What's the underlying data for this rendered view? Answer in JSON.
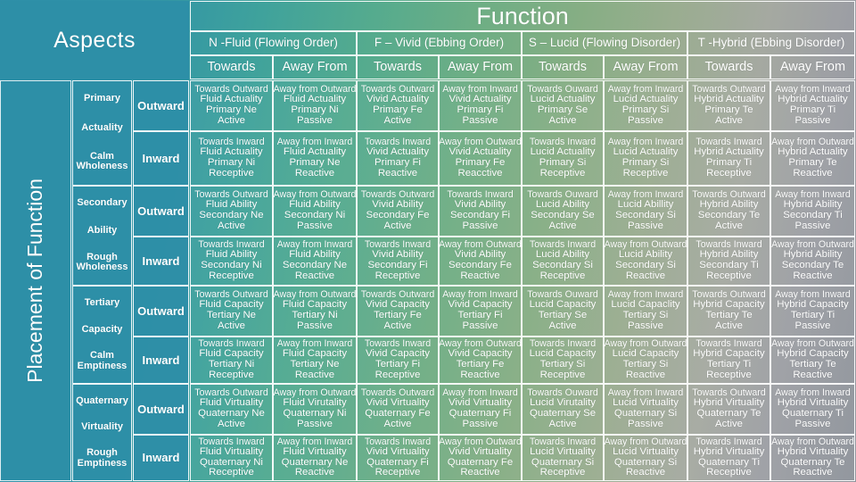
{
  "corner": {
    "aspects_label": "Aspects",
    "placement_label": "Placement of Function"
  },
  "header": {
    "function_label": "Function",
    "functions": [
      {
        "label": "N -Fluid (Flowing Order)"
      },
      {
        "label": "F – Vivid (Ebbing Order)"
      },
      {
        "label": "S – Lucid (Flowing Disorder)"
      },
      {
        "label": "T -Hybrid (Ebbing Disorder)"
      }
    ],
    "directions": [
      "Towards",
      "Away From",
      "Towards",
      "Away From",
      "Towards",
      "Away From",
      "Towards",
      "Away From"
    ]
  },
  "aspect_groups": [
    {
      "rank": "Primary",
      "aspect": "Actuality",
      "quality": "Calm Wholeness",
      "quality_line1": "Calm",
      "quality_line2": "Wholeness"
    },
    {
      "rank": "Secondary",
      "aspect": "Ability",
      "quality": "Rough Wholeness",
      "quality_line1": "Rough",
      "quality_line2": "Wholeness"
    },
    {
      "rank": "Tertiary",
      "aspect": "Capacity",
      "quality": "Calm Emptiness",
      "quality_line1": "Calm",
      "quality_line2": "Emptiness"
    },
    {
      "rank": "Quaternary",
      "aspect": "Virtuality",
      "quality": "Rough Emptiness",
      "quality_line1": "Rough",
      "quality_line2": "Emptiness"
    }
  ],
  "directions_rows": [
    "Outward",
    "Inward"
  ],
  "cells": [
    [
      [
        "Towards Outward",
        "Fluid Actuality",
        "Primary Ne",
        "Active"
      ],
      [
        "Away from Outward",
        "Fluid Actuality",
        "Primary Ni",
        "Passive"
      ],
      [
        "Towards Outward",
        "Vivid Actuality",
        "Primary Fe",
        "Active"
      ],
      [
        "Away from Inward",
        "Vivid Actuality",
        "Primary Fi",
        "Passive"
      ],
      [
        "Towards Ouward",
        "Lucid Actuality",
        "Primary Se",
        "Active"
      ],
      [
        "Away from Inward",
        "Lucid Actuality",
        "Primary Si",
        "Passive"
      ],
      [
        "Towards Outward",
        "Hybrid Actuality",
        "Primary Te",
        "Active"
      ],
      [
        "Away from Inward",
        "Hybrid Actuality",
        "Primary Ti",
        "Passive"
      ]
    ],
    [
      [
        "Towards Inward",
        "Fluid Actuality",
        "Primary Ni",
        "Receptive"
      ],
      [
        "Away from Inward",
        "Fluid Actuality",
        "Primary Ne",
        "Reactive"
      ],
      [
        "Towards Inward",
        "Vivid Actuality",
        "Primary Fi",
        "Reactive"
      ],
      [
        "Away from Outward",
        "Vivid Actuality",
        "Primary Fe",
        "Reacctive"
      ],
      [
        "Towards Inward",
        "Lucid Actuality",
        "Primary Si",
        "Receptive"
      ],
      [
        "Away from Inward",
        "Lucid Actuality",
        "Primary Si",
        "Receptive"
      ],
      [
        "Towards Inward",
        "Hybrid Actuality",
        "Primary Ti",
        "Receptive"
      ],
      [
        "Away from Outward",
        "Hybrid Actuality",
        "Primary Te",
        "Reactive"
      ]
    ],
    [
      [
        "Towards Outward",
        "Fluid Ability",
        "Secondary Ne",
        "Active"
      ],
      [
        "Away from Outward",
        "Fluid Ability",
        "Secondary Ni",
        "Passive"
      ],
      [
        "Towards Outward",
        "Vivid Ability",
        "Secondary Fe",
        "Active"
      ],
      [
        "Towards Inward",
        "Vivid Ability",
        "Secondary Fi",
        "Passive"
      ],
      [
        "Towards Ouward",
        "Lucid Ability",
        "Secondary Se",
        "Active"
      ],
      [
        "Away from Inward",
        "Lucid Abillity",
        "Secondary Si",
        "Passive"
      ],
      [
        "Towards Outward",
        "Hybrid Ability",
        "Secondary Te",
        "Active"
      ],
      [
        "Away from Inward",
        "Hybrid Ability",
        "Secondary Ti",
        "Passive"
      ]
    ],
    [
      [
        "Towards Inward",
        "Fluid Ability",
        "Secondary Ni",
        "Receptive"
      ],
      [
        "Away from Inward",
        "Fluid Ability",
        "Secondary Ne",
        "Reactive"
      ],
      [
        "Towards Inward",
        "Vivid Ability",
        "Secondary Fi",
        "Receptive"
      ],
      [
        "Away from Outward",
        "Vivid Ability",
        "Secondary Fe",
        "Reactive"
      ],
      [
        "Towards Inward",
        "Lucid Ability",
        "Secondary Si",
        "Receptive"
      ],
      [
        "Away from Outward",
        "Lucid Ability",
        "Secondary Si",
        "Reactive"
      ],
      [
        "Towards Inward",
        "Hybrid Ability",
        "Secondary Ti",
        "Receptive"
      ],
      [
        "Away from Outward",
        "Hybrid Ability",
        "Secondary Te",
        "Reactive"
      ]
    ],
    [
      [
        "Towards Outward",
        "Fluid Capacity",
        "Tertiary Ne",
        "Active"
      ],
      [
        "Away from Outward",
        "Fluid Capacity",
        "Tertiary Ni",
        "Passive"
      ],
      [
        "Towards Outward",
        "Vivid Capacity",
        "Tertiary Fe",
        "Active"
      ],
      [
        "Away from Inward",
        "Vivid Capacity",
        "Tertiary Fi",
        "Passive"
      ],
      [
        "Towards Ouward",
        "Lucid Capacity",
        "Tertiary Se",
        "Active"
      ],
      [
        "Away from Inward",
        "Lucid Capaclity",
        "Tertiary Si",
        "Passive"
      ],
      [
        "Towards Outward",
        "Hybrid Capacity",
        "Tertiary Te",
        "Active"
      ],
      [
        "Away from Inward",
        "Hybrid Capacity",
        "Tertiary Ti",
        "Passive"
      ]
    ],
    [
      [
        "Towards Inward",
        "Fluid Capacity",
        "Tertiary Ni",
        "Receptive"
      ],
      [
        "Away from Inward",
        "Fluid Capacity",
        "Tertiary Ne",
        "Reactive"
      ],
      [
        "Towards Inward",
        "Vivid Capacity",
        "Tertiary Fi",
        "Receptive"
      ],
      [
        "Away from Outward",
        "Vivid Capacity",
        "Tertiary Fe",
        "Reactive"
      ],
      [
        "Towards Inward",
        "Lucid Capacity",
        "Tertiary Si",
        "Receptive"
      ],
      [
        "Away from Outward",
        "Lucid Capacity",
        "Tertiary Si",
        "Reactive"
      ],
      [
        "Towards Inward",
        "Hybrid Capacity",
        "Tertiary Ti",
        "Receptive"
      ],
      [
        "Away from Outward",
        "Hybrid Capacity",
        "Tertiary Te",
        "Reactive"
      ]
    ],
    [
      [
        "Towards Outward",
        "Fluid Virtuality",
        "Quaternary Ne",
        "Active"
      ],
      [
        "Away from Outward",
        "Fluid Virutality",
        "Quaternary Ni",
        "Passive"
      ],
      [
        "Towards Outward",
        "Vivid Virtuality",
        "Quaternary Fe",
        "Active"
      ],
      [
        "Away from Inward",
        "Vivid Virtuality",
        "Quaternary Fi",
        "Passive"
      ],
      [
        "Towards Ouward",
        "Lucid Virutality",
        "Quaternary Se",
        "Active"
      ],
      [
        "Away from Inward",
        "Lucid Virtuality",
        "Quaternary Si",
        "Passive"
      ],
      [
        "Towards Outward",
        "Hybrid Virtuality",
        "Quaternary Te",
        "Active"
      ],
      [
        "Away from Inward",
        "Hybrid Virtuality",
        "Quaternary Ti",
        "Passive"
      ]
    ],
    [
      [
        "Towards Inward",
        "Fluid Virtuality",
        "Quaternary Ni",
        "Receptive"
      ],
      [
        "Away from Inward",
        "Fluid Virtuality",
        "Quaternary Ne",
        "Reactive"
      ],
      [
        "Towards Inward",
        "Vivid Virtuality",
        "Quaternary Fi",
        "Receptive"
      ],
      [
        "Away from Outward",
        "Vivid Virtuality",
        "Quaternary Fe",
        "Reactive"
      ],
      [
        "Towards Inward",
        "Lucid Virtuality",
        "Quaternary Si",
        "Receptive"
      ],
      [
        "Away from Outward",
        "Lucid Virtuality",
        "Quaternary Si",
        "Reactive"
      ],
      [
        "Towards Inward",
        "Hybrid Virtuality",
        "Quaternary Ti",
        "Receptive"
      ],
      [
        "Away from Outward",
        "Hybrid Virtuality",
        "Quaternary Te",
        "Reactive"
      ]
    ]
  ],
  "colors": {
    "panel_teal": "#2d8ea7",
    "gradient_start": "#2e8fa8",
    "gradient_mid": "#6fae84",
    "gradient_end": "#8f949b",
    "border": "#ffffff"
  }
}
